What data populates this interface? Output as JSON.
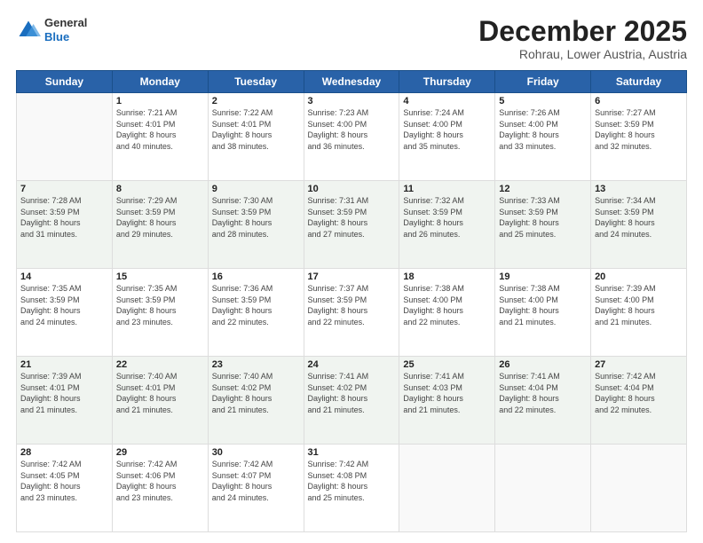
{
  "header": {
    "logo_general": "General",
    "logo_blue": "Blue",
    "month_title": "December 2025",
    "location": "Rohrau, Lower Austria, Austria"
  },
  "weekdays": [
    "Sunday",
    "Monday",
    "Tuesday",
    "Wednesday",
    "Thursday",
    "Friday",
    "Saturday"
  ],
  "weeks": [
    [
      {
        "day": "",
        "info": ""
      },
      {
        "day": "1",
        "info": "Sunrise: 7:21 AM\nSunset: 4:01 PM\nDaylight: 8 hours\nand 40 minutes."
      },
      {
        "day": "2",
        "info": "Sunrise: 7:22 AM\nSunset: 4:01 PM\nDaylight: 8 hours\nand 38 minutes."
      },
      {
        "day": "3",
        "info": "Sunrise: 7:23 AM\nSunset: 4:00 PM\nDaylight: 8 hours\nand 36 minutes."
      },
      {
        "day": "4",
        "info": "Sunrise: 7:24 AM\nSunset: 4:00 PM\nDaylight: 8 hours\nand 35 minutes."
      },
      {
        "day": "5",
        "info": "Sunrise: 7:26 AM\nSunset: 4:00 PM\nDaylight: 8 hours\nand 33 minutes."
      },
      {
        "day": "6",
        "info": "Sunrise: 7:27 AM\nSunset: 3:59 PM\nDaylight: 8 hours\nand 32 minutes."
      }
    ],
    [
      {
        "day": "7",
        "info": "Sunrise: 7:28 AM\nSunset: 3:59 PM\nDaylight: 8 hours\nand 31 minutes."
      },
      {
        "day": "8",
        "info": "Sunrise: 7:29 AM\nSunset: 3:59 PM\nDaylight: 8 hours\nand 29 minutes."
      },
      {
        "day": "9",
        "info": "Sunrise: 7:30 AM\nSunset: 3:59 PM\nDaylight: 8 hours\nand 28 minutes."
      },
      {
        "day": "10",
        "info": "Sunrise: 7:31 AM\nSunset: 3:59 PM\nDaylight: 8 hours\nand 27 minutes."
      },
      {
        "day": "11",
        "info": "Sunrise: 7:32 AM\nSunset: 3:59 PM\nDaylight: 8 hours\nand 26 minutes."
      },
      {
        "day": "12",
        "info": "Sunrise: 7:33 AM\nSunset: 3:59 PM\nDaylight: 8 hours\nand 25 minutes."
      },
      {
        "day": "13",
        "info": "Sunrise: 7:34 AM\nSunset: 3:59 PM\nDaylight: 8 hours\nand 24 minutes."
      }
    ],
    [
      {
        "day": "14",
        "info": "Sunrise: 7:35 AM\nSunset: 3:59 PM\nDaylight: 8 hours\nand 24 minutes."
      },
      {
        "day": "15",
        "info": "Sunrise: 7:35 AM\nSunset: 3:59 PM\nDaylight: 8 hours\nand 23 minutes."
      },
      {
        "day": "16",
        "info": "Sunrise: 7:36 AM\nSunset: 3:59 PM\nDaylight: 8 hours\nand 22 minutes."
      },
      {
        "day": "17",
        "info": "Sunrise: 7:37 AM\nSunset: 3:59 PM\nDaylight: 8 hours\nand 22 minutes."
      },
      {
        "day": "18",
        "info": "Sunrise: 7:38 AM\nSunset: 4:00 PM\nDaylight: 8 hours\nand 22 minutes."
      },
      {
        "day": "19",
        "info": "Sunrise: 7:38 AM\nSunset: 4:00 PM\nDaylight: 8 hours\nand 21 minutes."
      },
      {
        "day": "20",
        "info": "Sunrise: 7:39 AM\nSunset: 4:00 PM\nDaylight: 8 hours\nand 21 minutes."
      }
    ],
    [
      {
        "day": "21",
        "info": "Sunrise: 7:39 AM\nSunset: 4:01 PM\nDaylight: 8 hours\nand 21 minutes."
      },
      {
        "day": "22",
        "info": "Sunrise: 7:40 AM\nSunset: 4:01 PM\nDaylight: 8 hours\nand 21 minutes."
      },
      {
        "day": "23",
        "info": "Sunrise: 7:40 AM\nSunset: 4:02 PM\nDaylight: 8 hours\nand 21 minutes."
      },
      {
        "day": "24",
        "info": "Sunrise: 7:41 AM\nSunset: 4:02 PM\nDaylight: 8 hours\nand 21 minutes."
      },
      {
        "day": "25",
        "info": "Sunrise: 7:41 AM\nSunset: 4:03 PM\nDaylight: 8 hours\nand 21 minutes."
      },
      {
        "day": "26",
        "info": "Sunrise: 7:41 AM\nSunset: 4:04 PM\nDaylight: 8 hours\nand 22 minutes."
      },
      {
        "day": "27",
        "info": "Sunrise: 7:42 AM\nSunset: 4:04 PM\nDaylight: 8 hours\nand 22 minutes."
      }
    ],
    [
      {
        "day": "28",
        "info": "Sunrise: 7:42 AM\nSunset: 4:05 PM\nDaylight: 8 hours\nand 23 minutes."
      },
      {
        "day": "29",
        "info": "Sunrise: 7:42 AM\nSunset: 4:06 PM\nDaylight: 8 hours\nand 23 minutes."
      },
      {
        "day": "30",
        "info": "Sunrise: 7:42 AM\nSunset: 4:07 PM\nDaylight: 8 hours\nand 24 minutes."
      },
      {
        "day": "31",
        "info": "Sunrise: 7:42 AM\nSunset: 4:08 PM\nDaylight: 8 hours\nand 25 minutes."
      },
      {
        "day": "",
        "info": ""
      },
      {
        "day": "",
        "info": ""
      },
      {
        "day": "",
        "info": ""
      }
    ]
  ]
}
